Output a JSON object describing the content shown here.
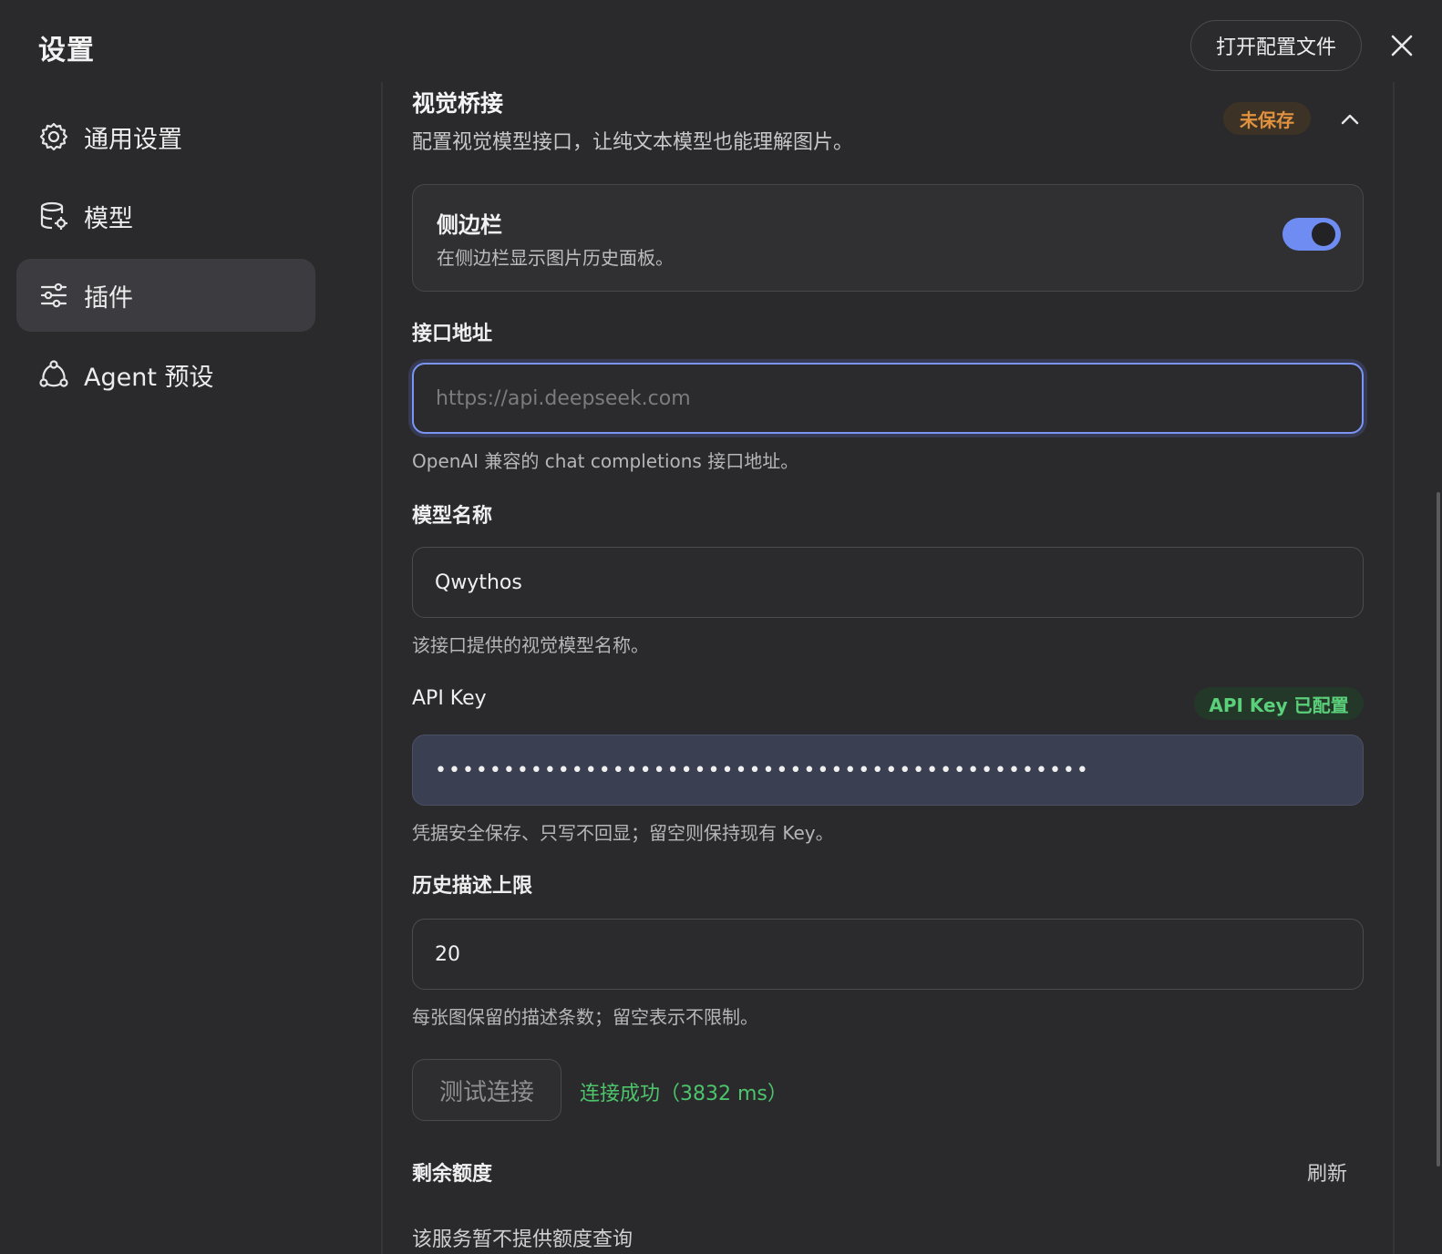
{
  "header": {
    "title": "设置",
    "open_config_label": "打开配置文件",
    "close_icon": "close-icon"
  },
  "sidebar": {
    "items": [
      {
        "label": "通用设置",
        "icon": "gear-icon",
        "active": false
      },
      {
        "label": "模型",
        "icon": "database-icon",
        "active": false
      },
      {
        "label": "插件",
        "icon": "sliders-icon",
        "active": true
      },
      {
        "label": "Agent 预设",
        "icon": "agent-icon",
        "active": false
      }
    ]
  },
  "section": {
    "title": "视觉桥接",
    "description": "配置视觉模型接口，让纯文本模型也能理解图片。",
    "status_badge": "未保存",
    "collapse_icon": "chevron-up-icon"
  },
  "sidebar_card": {
    "title": "侧边栏",
    "description": "在侧边栏显示图片历史面板。",
    "enabled": true
  },
  "fields": {
    "endpoint": {
      "label": "接口地址",
      "value": "",
      "placeholder": "https://api.deepseek.com",
      "help": "OpenAI 兼容的 chat completions 接口地址。"
    },
    "model_name": {
      "label": "模型名称",
      "value": "Qwythos",
      "help": "该接口提供的视觉模型名称。"
    },
    "api_key": {
      "label": "API Key",
      "badge": "API Key 已配置",
      "value": "••••••••••••••••••••••••••••••••••••••••••••••••",
      "help": "凭据安全保存、只写不回显；留空则保持现有 Key。"
    },
    "history_limit": {
      "label": "历史描述上限",
      "value": "20",
      "help": "每张图保留的描述条数；留空表示不限制。"
    }
  },
  "test": {
    "button_label": "测试连接",
    "result": "连接成功（3832 ms）"
  },
  "quota": {
    "title": "剩余额度",
    "refresh_label": "刷新",
    "note": "该服务暂不提供额度查询"
  },
  "colors": {
    "accent": "#6f8cf2",
    "success": "#4dc46b",
    "warning": "#e0923f",
    "background": "#2a2a2c"
  }
}
